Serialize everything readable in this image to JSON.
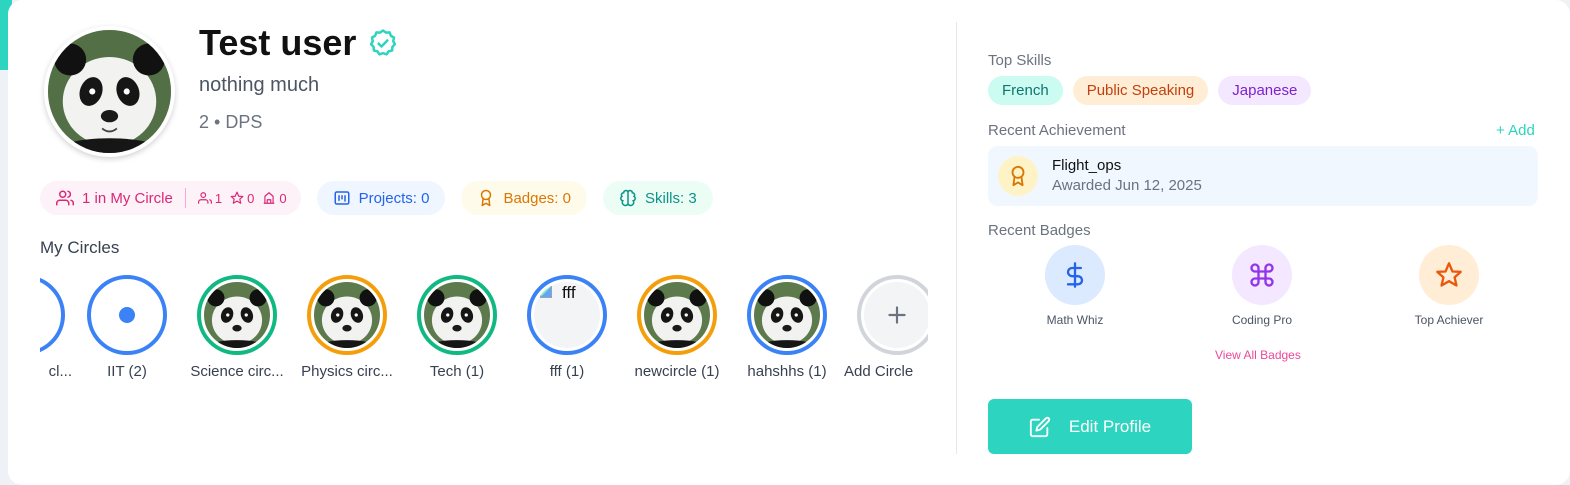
{
  "profile": {
    "name": "Test user",
    "tagline": "nothing much",
    "meta": "2 • DPS"
  },
  "stats": {
    "circle_label": "1 in My Circle",
    "circle_people": "1",
    "circle_stars": "0",
    "circle_buildings": "0",
    "projects": "Projects: 0",
    "badges": "Badges: 0",
    "skills": "Skills: 3"
  },
  "circles": {
    "title": "My Circles",
    "items": [
      {
        "label": "cl...",
        "ring": "#3b82f6",
        "icon": "partial-circle"
      },
      {
        "label": "IIT (2)",
        "ring": "#3b82f6",
        "icon": "dot"
      },
      {
        "label": "Science circ...",
        "ring": "#10b981",
        "icon": "panda-photo"
      },
      {
        "label": "Physics circ...",
        "ring": "#f59e0b",
        "icon": "panda-photo"
      },
      {
        "label": "Tech (1)",
        "ring": "#10b981",
        "icon": "panda-photo"
      },
      {
        "label": "fff (1)",
        "ring": "#3b82f6",
        "icon": "broken-image",
        "alt": "fff"
      },
      {
        "label": "newcircle (1)",
        "ring": "#f59e0b",
        "icon": "panda-photo"
      },
      {
        "label": "hahshhs (1)",
        "ring": "#3b82f6",
        "icon": "panda-photo"
      },
      {
        "label": "Add Circle",
        "ring": "#d1d5db",
        "icon": "plus-icon"
      }
    ]
  },
  "right": {
    "top_skills_label": "Top Skills",
    "skills": [
      {
        "label": "French",
        "bg": "#ccfbf1",
        "fg": "#0f766e"
      },
      {
        "label": "Public Speaking",
        "bg": "#ffedd5",
        "fg": "#c2410c"
      },
      {
        "label": "Japanese",
        "bg": "#f3e8ff",
        "fg": "#7e22ce"
      }
    ],
    "recent_achievement_label": "Recent Achievement",
    "add_label": "+ Add",
    "achievement": {
      "title": "Flight_ops",
      "date": "Awarded Jun 12, 2025"
    },
    "recent_badges_label": "Recent Badges",
    "badges": [
      {
        "label": "Math Whiz",
        "icon": "dollar-icon",
        "bg": "#dbeafe"
      },
      {
        "label": "Coding Pro",
        "icon": "command-icon",
        "bg": "#f3e8ff"
      },
      {
        "label": "Top Achiever",
        "icon": "star-icon",
        "bg": "#ffedd5"
      }
    ],
    "view_all": "View All Badges",
    "edit_profile": "Edit Profile"
  },
  "colors": {
    "accent": "#2dd4bf",
    "pink": "#db2777",
    "blue": "#2563eb",
    "amber": "#d97706",
    "teal": "#0d9488"
  }
}
